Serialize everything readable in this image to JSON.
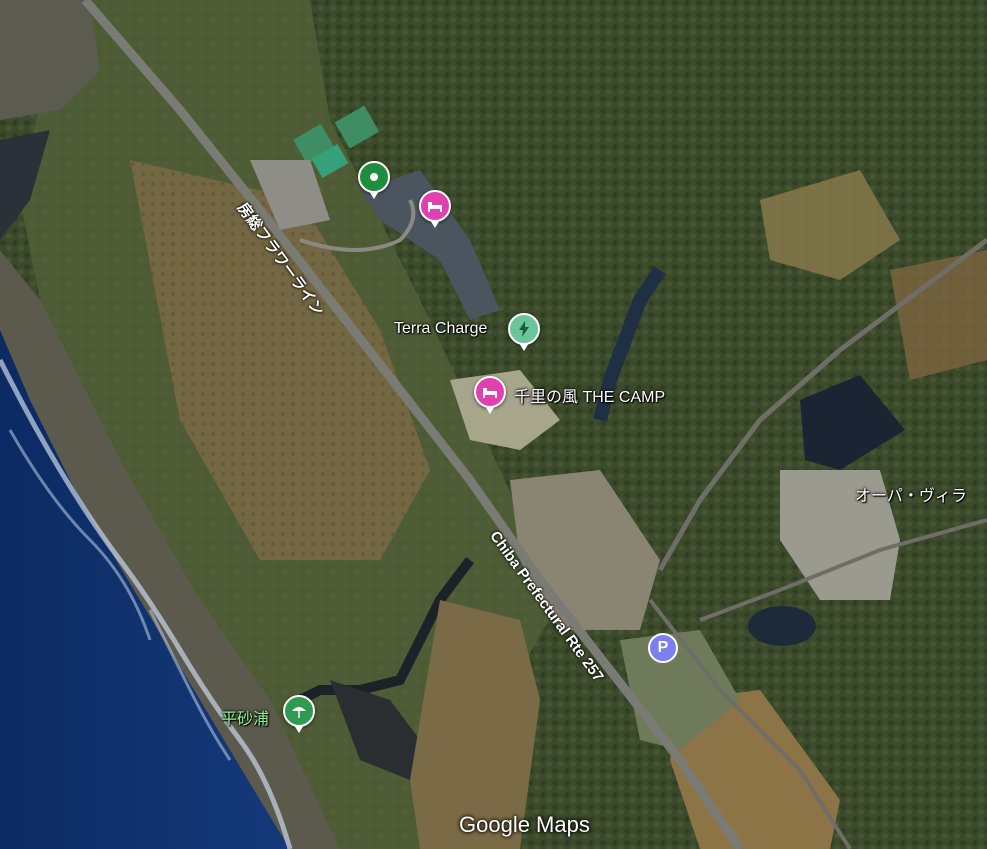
{
  "map": {
    "places": {
      "terra_charge": "Terra Charge",
      "camp": "千里の風 THE CAMP",
      "opa_villa": "オーパ・ヴィラ",
      "hirasunaura": "平砂浦"
    },
    "roads": {
      "flower_line": "房総フラワーライン",
      "rte257": "Chiba Prefectural Rte 257"
    },
    "parking_symbol": "P",
    "watermark": "Google Maps"
  },
  "colors": {
    "ocean": "#0f2f6e",
    "place_pin_green": "#1e8e3e",
    "hotel_pin": "#e040b0",
    "charge_pin": "#6cc49a",
    "parking_pin": "#7b7ff0"
  }
}
